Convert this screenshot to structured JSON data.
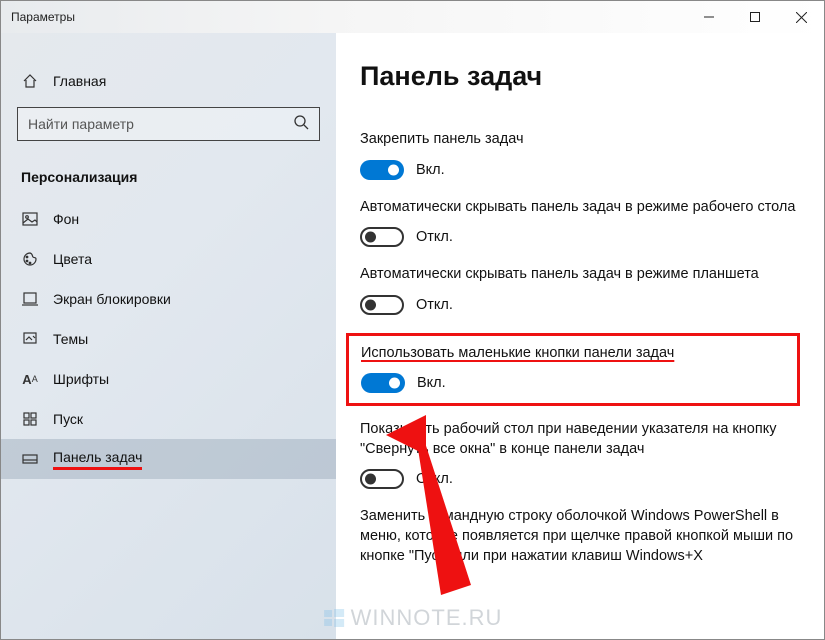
{
  "window": {
    "title": "Параметры"
  },
  "sidebar": {
    "home": "Главная",
    "search_placeholder": "Найти параметр",
    "category": "Персонализация",
    "items": [
      {
        "label": "Фон"
      },
      {
        "label": "Цвета"
      },
      {
        "label": "Экран блокировки"
      },
      {
        "label": "Темы"
      },
      {
        "label": "Шрифты"
      },
      {
        "label": "Пуск"
      },
      {
        "label": "Панель задач"
      }
    ]
  },
  "main": {
    "heading": "Панель задач",
    "settings": [
      {
        "label": "Закрепить панель задач",
        "state": "Вкл.",
        "on": true
      },
      {
        "label": "Автоматически скрывать панель задач в режиме рабочего стола",
        "state": "Откл.",
        "on": false
      },
      {
        "label": "Автоматически скрывать панель задач в режиме планшета",
        "state": "Откл.",
        "on": false
      },
      {
        "label": "Использовать маленькие кнопки панели задач",
        "state": "Вкл.",
        "on": true
      },
      {
        "label": "Показывать рабочий стол при наведении указателя на кнопку \"Свернуть все окна\" в конце панели задач",
        "state": "Откл.",
        "on": false
      },
      {
        "label": "Заменить командную строку оболочкой Windows PowerShell в меню, которое появляется при щелчке правой кнопкой мыши по кнопке \"Пуск\" или при нажатии клавиш Windows+X",
        "state": "",
        "on": null
      }
    ]
  },
  "watermark": "WINNOTE.RU",
  "annotation": {
    "highlight_index": 3,
    "arrow_target": "toggle-use-small-taskbar-buttons"
  }
}
